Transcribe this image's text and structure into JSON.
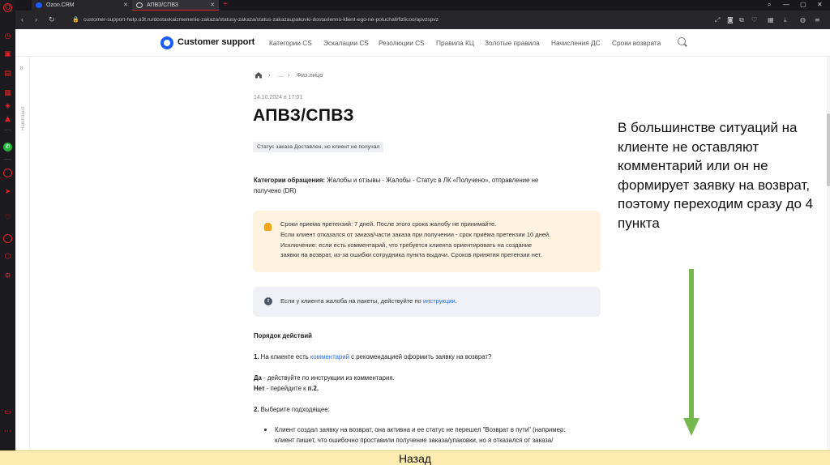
{
  "browser": {
    "tabs": [
      {
        "label": "Ozon.CRM",
        "active": false
      },
      {
        "label": "АПВЗ/СПВЗ",
        "active": true
      }
    ],
    "url": "customer-support-help.o3t.ru/dostavkaizmenenie-zakaza/statusy-zakaza/status-zakazaupakovki-dostavlenno-klient-ego-ne-poluchall/fizlicoo/apvzspvz",
    "accent_color": "#e0232a"
  },
  "site": {
    "logo_text": "Customer support",
    "nav": [
      "Категории CS",
      "Эскалации CS",
      "Резолюции CS",
      "Правила КЦ",
      "Золотые правила",
      "Начисления ДС",
      "Сроки возврата"
    ],
    "side_label": "Навигация"
  },
  "article": {
    "breadcrumb": {
      "ellipsis": "...",
      "current": "Физ.лицо"
    },
    "date": "14.10.2024 в 17:01",
    "title": "АПВЗ/СПВЗ",
    "badge": "Статус заказа Доставлен, но клиент не получал",
    "category_label": "Категории обращения:",
    "category_text": " Жалобы и отзывы - Жалобы - Статус в ЛК «Получено», отправление не",
    "category_text2": "получено (DR)",
    "warning_lines": [
      "Сроки приема претензий: 7 дней. После этого срока жалобу не принимайте.",
      "Если клиент отказался от заказа/части заказа при получении - срок приёма претензии 10 дней.",
      "Исключение: если есть комментарий, что требуется клиента ориентировать на создание",
      "заявки на возврат, из-за ошибки сотрудника пункта выдачи. Сроков принятия претензии нет."
    ],
    "info_text": "Если у клиента жалоба на пакеты, действуйте по ",
    "info_link": "инструкции",
    "info_end": ".",
    "steps_heading": "Порядок действий",
    "step1_num": "1.",
    "step1_pre": " На клиенте есть ",
    "step1_link": "комментарий",
    "step1_post": " с рекомендацией оформить заявку на возврат?",
    "yes_label": "Да",
    "yes_text": " - действуйте по инструкции из комментария.",
    "no_label": "Нет",
    "no_text": " - перейдите к ",
    "no_ref": "п.2.",
    "step2_num": "2.",
    "step2_text": " Выберите подходящее:",
    "bullet_line1": "Клиент создал заявку на возврат, она активна и ее статус не перешел \"Возврат в пути\" (например:",
    "bullet_line2": "клиент пишет, что ошибочно проставили получение заказа/упаковки, но я отказался от заказа/"
  },
  "annotation": {
    "text": "В большинстве ситуаций на клиенте не оставляют комментарий или он не формирует заявку на возврат, поэтому переходим сразу до 4 пункта",
    "arrow_color": "#76b74e"
  },
  "footer": {
    "back_label": "Назад"
  }
}
